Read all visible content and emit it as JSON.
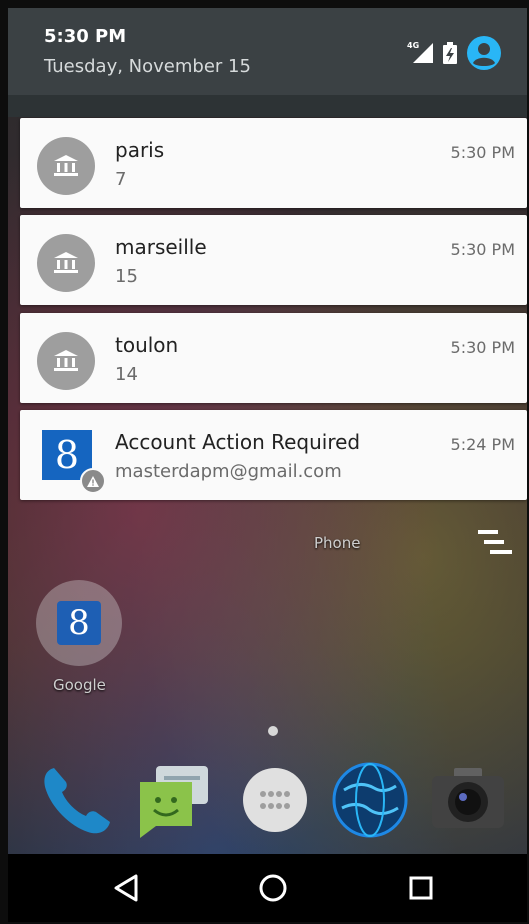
{
  "status": {
    "time": "5:30 PM",
    "date": "Tuesday, November 15",
    "network": "4G"
  },
  "notifications": [
    {
      "title": "paris",
      "subtitle": "7",
      "time": "5:30 PM",
      "icon": "bank-icon"
    },
    {
      "title": "marseille",
      "subtitle": "15",
      "time": "5:30 PM",
      "icon": "bank-icon"
    },
    {
      "title": "toulon",
      "subtitle": "14",
      "time": "5:30 PM",
      "icon": "bank-icon"
    },
    {
      "title": "Account Action Required",
      "subtitle": "masterdapm@gmail.com",
      "time": "5:24 PM",
      "icon": "google-g-icon",
      "logo_glyph": "8"
    }
  ],
  "home": {
    "phone_label": "Phone",
    "google_label": "Google",
    "google_glyph": "8"
  },
  "colors": {
    "header": "#3b4144",
    "card": "#fafafa",
    "avatar": "#9e9e9e",
    "accent": "#29b6f6",
    "google_blue": "#1565c0"
  }
}
